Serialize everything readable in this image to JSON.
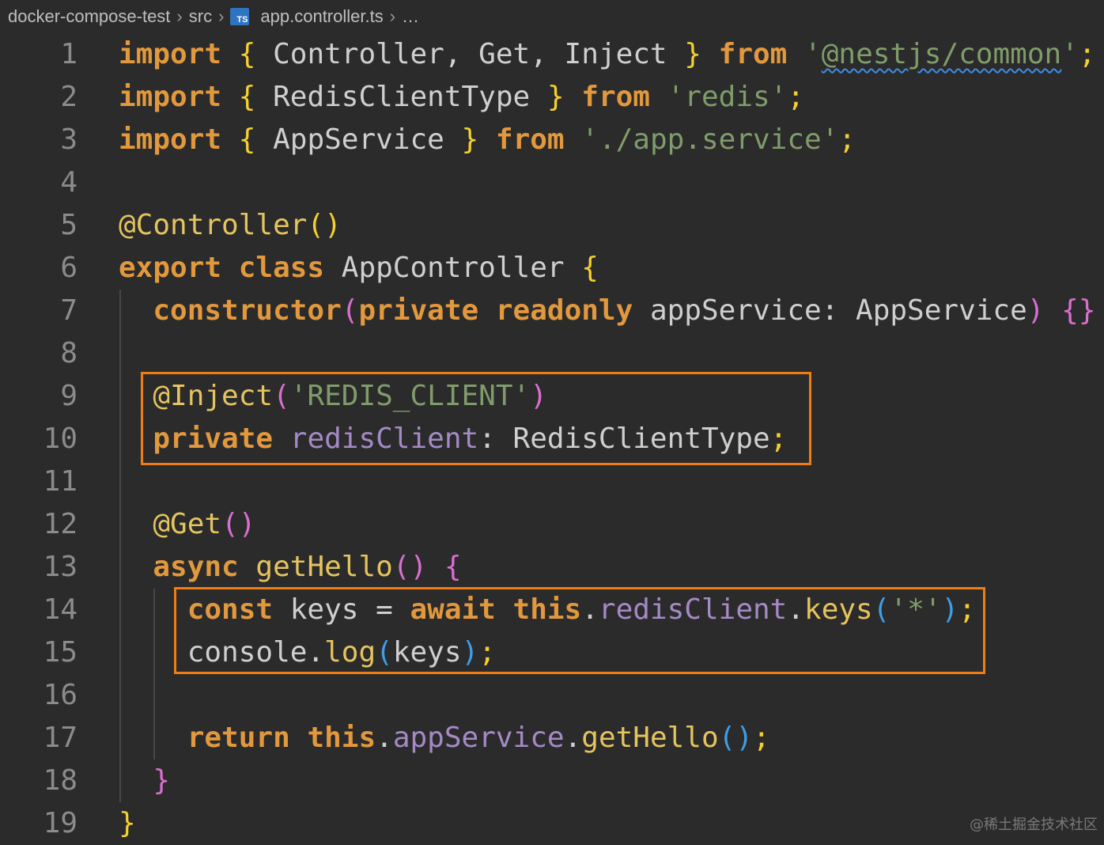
{
  "breadcrumb": {
    "items": [
      "docker-compose-test",
      "src",
      "app.controller.ts",
      "…"
    ],
    "separator": ">",
    "file_icon_label": "TS"
  },
  "editor": {
    "language": "typescript",
    "highlight_color": "#f07d14",
    "line_numbers": [
      "1",
      "2",
      "3",
      "4",
      "5",
      "6",
      "7",
      "8",
      "9",
      "10",
      "11",
      "12",
      "13",
      "14",
      "15",
      "16",
      "17",
      "18",
      "19"
    ],
    "lines": [
      {
        "indent": "",
        "tokens": [
          {
            "text": "import",
            "class": "kw"
          },
          {
            "text": " "
          },
          {
            "text": "{",
            "class": "br1"
          },
          {
            "text": " Controller, Get, Inject ",
            "class": "id"
          },
          {
            "text": "}",
            "class": "br1"
          },
          {
            "text": " "
          },
          {
            "text": "from",
            "class": "kw"
          },
          {
            "text": " "
          },
          {
            "text": "'",
            "class": "str"
          },
          {
            "text": "@nestjs/common",
            "class": "str squiggle"
          },
          {
            "text": "'",
            "class": "str"
          },
          {
            "text": ";",
            "class": "br1"
          }
        ]
      },
      {
        "indent": "",
        "tokens": [
          {
            "text": "import",
            "class": "kw"
          },
          {
            "text": " "
          },
          {
            "text": "{",
            "class": "br1"
          },
          {
            "text": " RedisClientType ",
            "class": "id"
          },
          {
            "text": "}",
            "class": "br1"
          },
          {
            "text": " "
          },
          {
            "text": "from",
            "class": "kw"
          },
          {
            "text": " "
          },
          {
            "text": "'redis'",
            "class": "str"
          },
          {
            "text": ";",
            "class": "br1"
          }
        ]
      },
      {
        "indent": "",
        "tokens": [
          {
            "text": "import",
            "class": "kw"
          },
          {
            "text": " "
          },
          {
            "text": "{",
            "class": "br1"
          },
          {
            "text": " AppService ",
            "class": "id"
          },
          {
            "text": "}",
            "class": "br1"
          },
          {
            "text": " "
          },
          {
            "text": "from",
            "class": "kw"
          },
          {
            "text": " "
          },
          {
            "text": "'./app.service'",
            "class": "str"
          },
          {
            "text": ";",
            "class": "br1"
          }
        ]
      },
      {
        "indent": "",
        "tokens": []
      },
      {
        "indent": "",
        "tokens": [
          {
            "text": "@Controller",
            "class": "fn"
          },
          {
            "text": "()",
            "class": "br1"
          }
        ]
      },
      {
        "indent": "",
        "tokens": [
          {
            "text": "export",
            "class": "kw"
          },
          {
            "text": " "
          },
          {
            "text": "class",
            "class": "kw"
          },
          {
            "text": " AppController ",
            "class": "id"
          },
          {
            "text": "{",
            "class": "br1"
          }
        ]
      },
      {
        "indent": "  ",
        "tokens": [
          {
            "text": "constructor",
            "class": "kw"
          },
          {
            "text": "(",
            "class": "br2"
          },
          {
            "text": "private",
            "class": "kw"
          },
          {
            "text": " "
          },
          {
            "text": "readonly",
            "class": "kw"
          },
          {
            "text": " appService: AppService",
            "class": "id"
          },
          {
            "text": ")",
            "class": "br2"
          },
          {
            "text": " "
          },
          {
            "text": "{}",
            "class": "br2"
          }
        ]
      },
      {
        "indent": "",
        "tokens": []
      },
      {
        "indent": "  ",
        "tokens": [
          {
            "text": "@Inject",
            "class": "fn"
          },
          {
            "text": "(",
            "class": "br2"
          },
          {
            "text": "'REDIS_CLIENT'",
            "class": "str"
          },
          {
            "text": ")",
            "class": "br2"
          }
        ]
      },
      {
        "indent": "  ",
        "tokens": [
          {
            "text": "private",
            "class": "kw"
          },
          {
            "text": " "
          },
          {
            "text": "redisClient",
            "class": "prop"
          },
          {
            "text": ": RedisClientType",
            "class": "id"
          },
          {
            "text": ";",
            "class": "br1"
          }
        ]
      },
      {
        "indent": "",
        "tokens": []
      },
      {
        "indent": "  ",
        "tokens": [
          {
            "text": "@Get",
            "class": "fn"
          },
          {
            "text": "()",
            "class": "br2"
          }
        ]
      },
      {
        "indent": "  ",
        "tokens": [
          {
            "text": "async",
            "class": "kw"
          },
          {
            "text": " "
          },
          {
            "text": "getHello",
            "class": "fn"
          },
          {
            "text": "()",
            "class": "br2"
          },
          {
            "text": " "
          },
          {
            "text": "{",
            "class": "br2"
          }
        ]
      },
      {
        "indent": "    ",
        "tokens": [
          {
            "text": "const",
            "class": "kw"
          },
          {
            "text": " keys = ",
            "class": "id"
          },
          {
            "text": "await",
            "class": "kw"
          },
          {
            "text": " "
          },
          {
            "text": "this",
            "class": "kw"
          },
          {
            "text": ".",
            "class": "id"
          },
          {
            "text": "redisClient",
            "class": "prop"
          },
          {
            "text": ".",
            "class": "id"
          },
          {
            "text": "keys",
            "class": "fn"
          },
          {
            "text": "(",
            "class": "br3"
          },
          {
            "text": "'*'",
            "class": "str"
          },
          {
            "text": ")",
            "class": "br3"
          },
          {
            "text": ";",
            "class": "br1"
          }
        ]
      },
      {
        "indent": "    ",
        "tokens": [
          {
            "text": "console.",
            "class": "id"
          },
          {
            "text": "log",
            "class": "fn"
          },
          {
            "text": "(",
            "class": "br3"
          },
          {
            "text": "keys",
            "class": "id"
          },
          {
            "text": ")",
            "class": "br3"
          },
          {
            "text": ";",
            "class": "br1"
          }
        ]
      },
      {
        "indent": "",
        "tokens": []
      },
      {
        "indent": "    ",
        "tokens": [
          {
            "text": "return",
            "class": "kw"
          },
          {
            "text": " "
          },
          {
            "text": "this",
            "class": "kw"
          },
          {
            "text": ".",
            "class": "id"
          },
          {
            "text": "appService",
            "class": "prop"
          },
          {
            "text": ".",
            "class": "id"
          },
          {
            "text": "getHello",
            "class": "fn"
          },
          {
            "text": "()",
            "class": "br3"
          },
          {
            "text": ";",
            "class": "br1"
          }
        ]
      },
      {
        "indent": "  ",
        "tokens": [
          {
            "text": "}",
            "class": "br2"
          }
        ]
      },
      {
        "indent": "",
        "tokens": [
          {
            "text": "}",
            "class": "br1"
          }
        ]
      }
    ]
  },
  "watermark": "@稀土掘金技术社区"
}
